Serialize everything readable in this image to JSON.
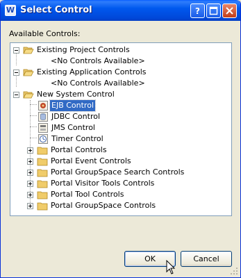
{
  "window": {
    "title": "Select Control",
    "app_icon_letter": "W"
  },
  "label_available": "Available Controls:",
  "tree": {
    "nodes": [
      {
        "label": "Existing Project Controls",
        "expanded": true,
        "type": "folder"
      },
      {
        "label": "<No Controls Available>",
        "type": "placeholder"
      },
      {
        "label": "Existing Application Controls",
        "expanded": true,
        "type": "folder"
      },
      {
        "label": "<No Controls Available>",
        "type": "placeholder"
      },
      {
        "label": "New System Control",
        "expanded": true,
        "type": "folder"
      },
      {
        "label": "EJB Control",
        "type": "control",
        "icon": "ejb-icon",
        "selected": true
      },
      {
        "label": "JDBC Control",
        "type": "control",
        "icon": "jdbc-icon"
      },
      {
        "label": "JMS Control",
        "type": "control",
        "icon": "jms-icon"
      },
      {
        "label": "Timer Control",
        "type": "control",
        "icon": "timer-icon"
      },
      {
        "label": "Portal Controls",
        "expanded": false,
        "type": "folder"
      },
      {
        "label": "Portal Event Controls",
        "expanded": false,
        "type": "folder"
      },
      {
        "label": "Portal GroupSpace Search Controls",
        "expanded": false,
        "type": "folder"
      },
      {
        "label": "Portal Visitor Tools Controls",
        "expanded": false,
        "type": "folder"
      },
      {
        "label": "Portal Tool Controls",
        "expanded": false,
        "type": "folder"
      },
      {
        "label": "Portal GroupSpace Controls",
        "expanded": false,
        "type": "folder"
      }
    ]
  },
  "buttons": {
    "ok": "OK",
    "cancel": "Cancel"
  },
  "colors": {
    "titlebar": "#0058ee",
    "selection": "#316ac5",
    "dialog_bg": "#ece9d8",
    "tree_border": "#7f9db9"
  }
}
